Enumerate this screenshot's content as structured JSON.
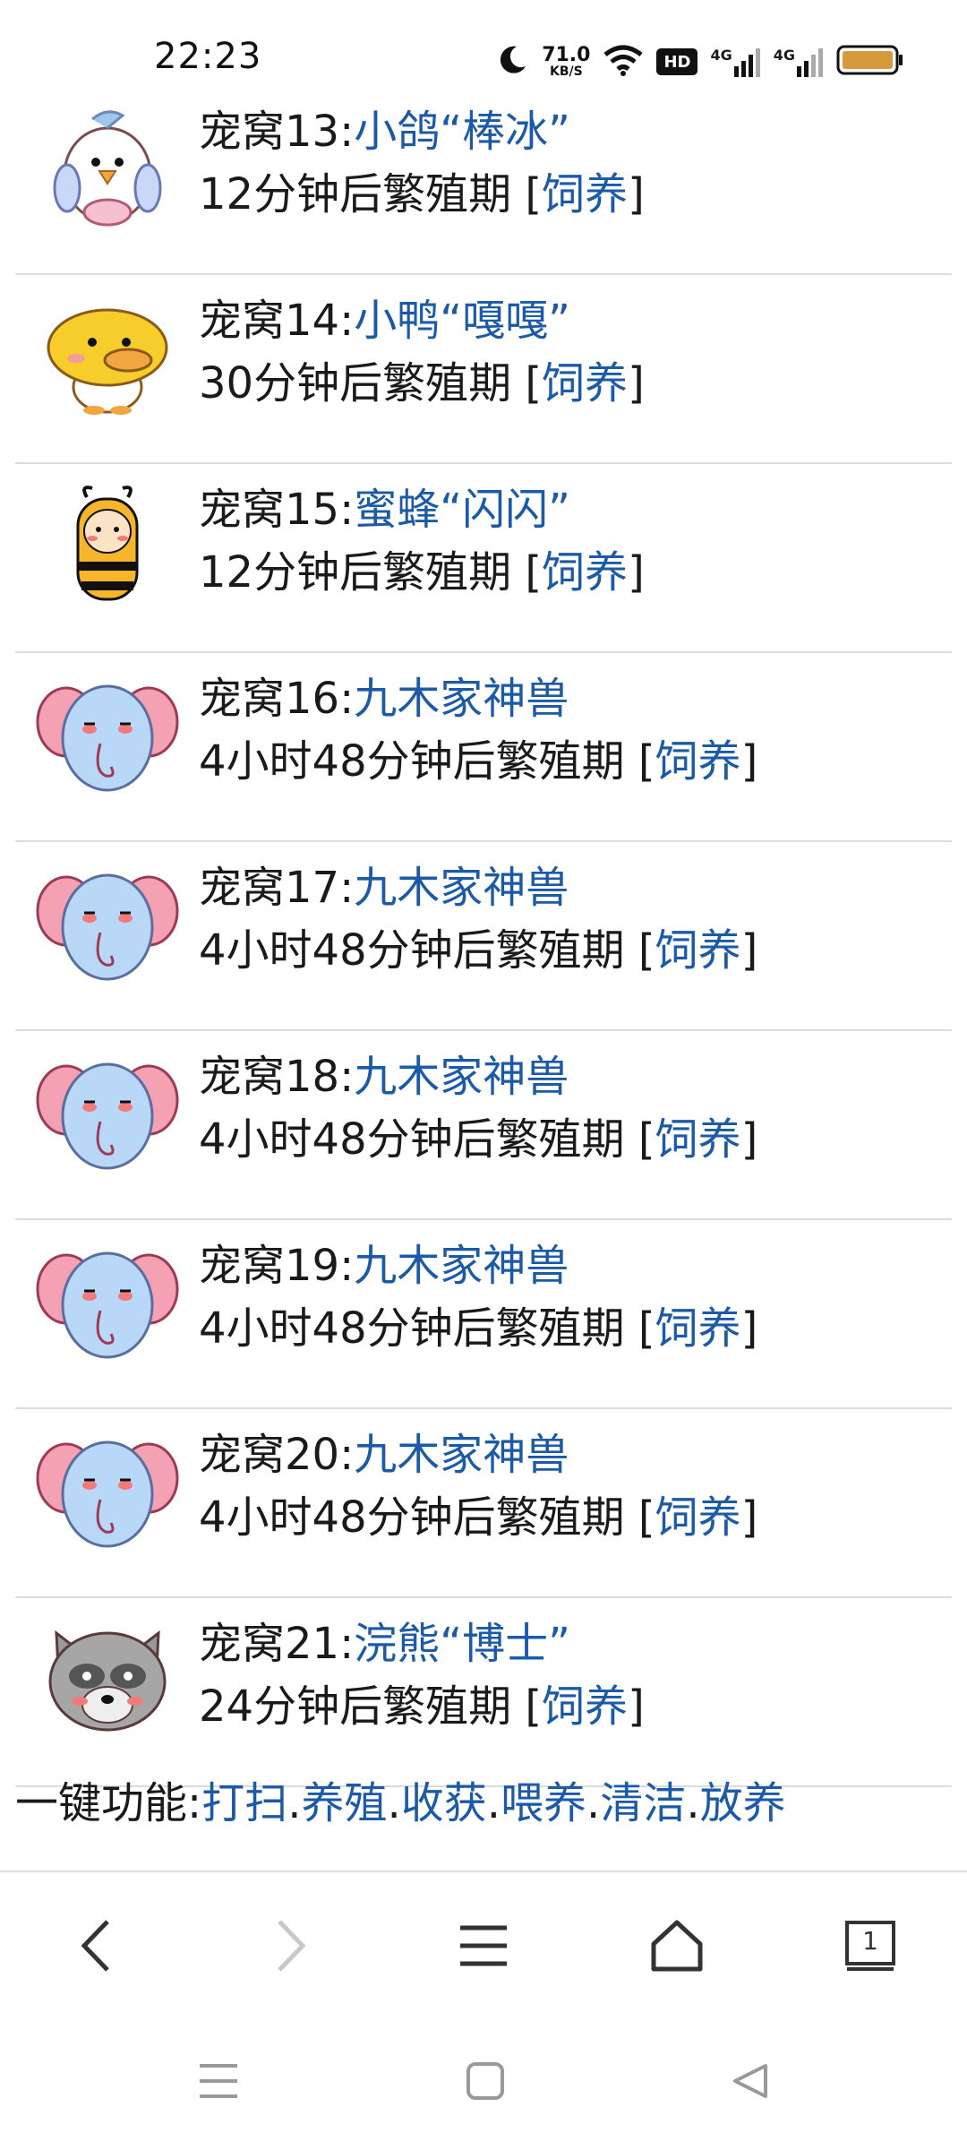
{
  "status_bar": {
    "time": "22:23",
    "net_speed_value": "71.0",
    "net_speed_unit": "KB/S",
    "hd_badge": "HD",
    "signal1_label": "4G",
    "signal2_label": "4G"
  },
  "pets": [
    {
      "prefix": "宠窝13:",
      "name": "小鸽“棒冰”",
      "timer": "12分钟后繁殖期 [",
      "action": "饲养",
      "suffix": "]",
      "icon": "pigeon-icon"
    },
    {
      "prefix": "宠窝14:",
      "name": "小鸭“嘎嘎”",
      "timer": "30分钟后繁殖期 [",
      "action": "饲养",
      "suffix": "]",
      "icon": "duck-icon"
    },
    {
      "prefix": "宠窝15:",
      "name": "蜜蜂“闪闪”",
      "timer": "12分钟后繁殖期 [",
      "action": "饲养",
      "suffix": "]",
      "icon": "bee-icon"
    },
    {
      "prefix": "宠窝16:",
      "name": "九木家神兽",
      "timer": "4小时48分钟后繁殖期 [",
      "action": "饲养",
      "suffix": "]",
      "icon": "elephant-icon"
    },
    {
      "prefix": "宠窝17:",
      "name": "九木家神兽",
      "timer": "4小时48分钟后繁殖期 [",
      "action": "饲养",
      "suffix": "]",
      "icon": "elephant-icon"
    },
    {
      "prefix": "宠窝18:",
      "name": "九木家神兽",
      "timer": "4小时48分钟后繁殖期 [",
      "action": "饲养",
      "suffix": "]",
      "icon": "elephant-icon"
    },
    {
      "prefix": "宠窝19:",
      "name": "九木家神兽",
      "timer": "4小时48分钟后繁殖期 [",
      "action": "饲养",
      "suffix": "]",
      "icon": "elephant-icon"
    },
    {
      "prefix": "宠窝20:",
      "name": "九木家神兽",
      "timer": "4小时48分钟后繁殖期 [",
      "action": "饲养",
      "suffix": "]",
      "icon": "elephant-icon"
    },
    {
      "prefix": "宠窝21:",
      "name": "浣熊“博士”",
      "timer": "24分钟后繁殖期 [",
      "action": "饲养",
      "suffix": "]",
      "icon": "raccoon-icon"
    }
  ],
  "quick_actions": {
    "label": "一键功能:",
    "items": [
      "打扫",
      "养殖",
      "收获",
      "喂养",
      "清洁",
      "放养"
    ],
    "separator": "."
  },
  "toolbar": {
    "back_icon": "back-icon",
    "forward_icon": "forward-icon",
    "menu_icon": "menu-icon",
    "home_icon": "home-icon",
    "tabs_count": "1"
  },
  "colors": {
    "link": "#1a5aa8",
    "text": "#1a1a1a",
    "divider": "#dcdcdc"
  }
}
